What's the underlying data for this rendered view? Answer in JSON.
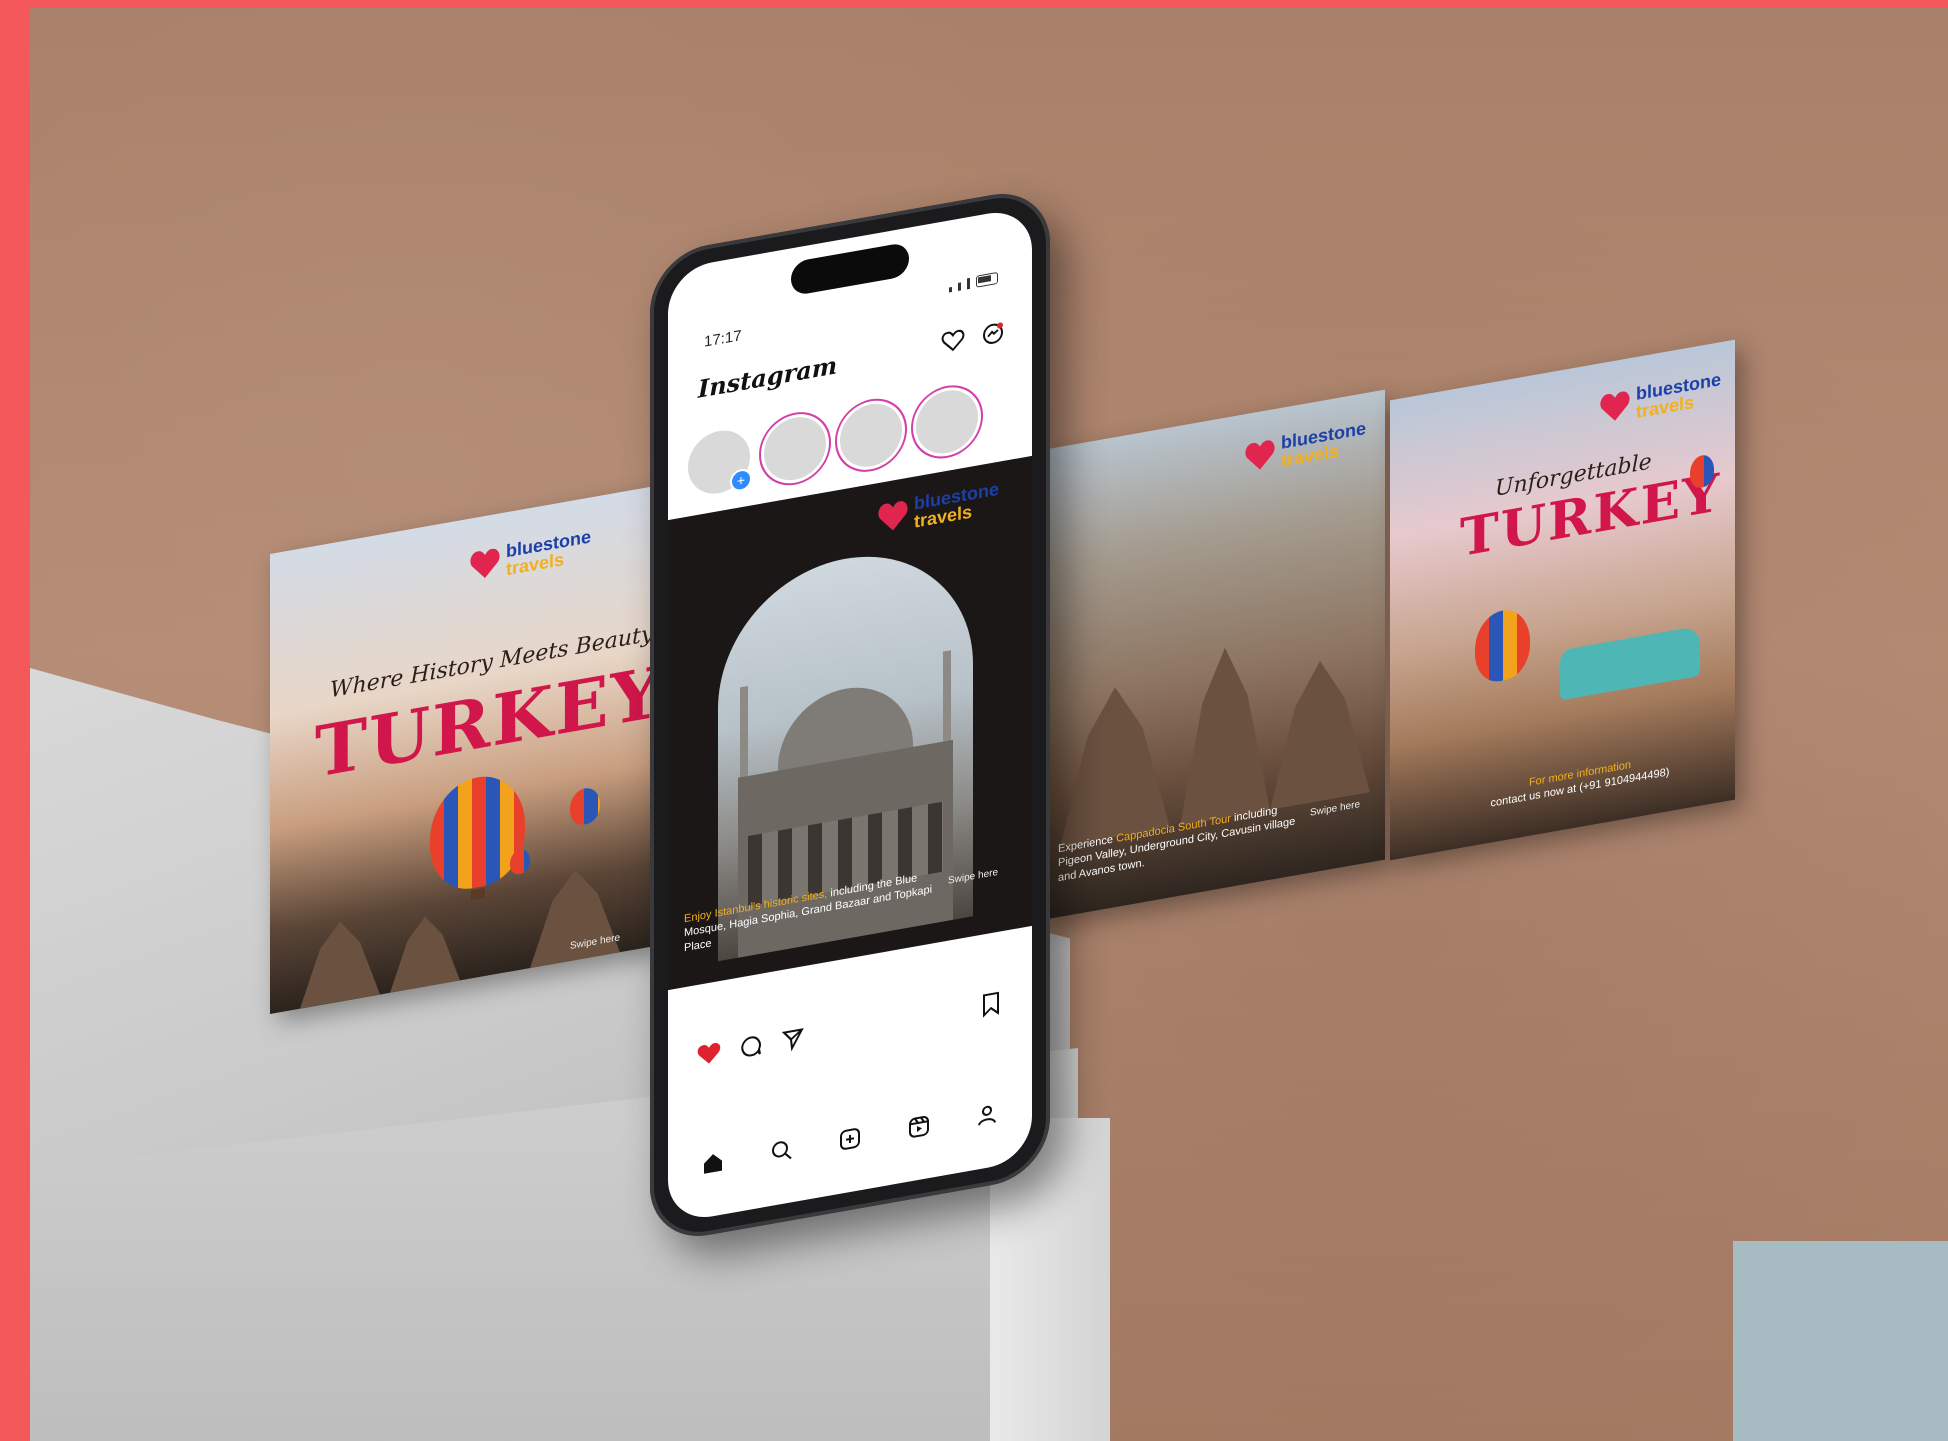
{
  "brand": {
    "name_line1": "bluestone",
    "name_line2": "travels"
  },
  "post1": {
    "script_title": "Where History Meets Beauty",
    "big_title": "TURKEY",
    "swipe": "Swipe here"
  },
  "post2": {
    "caption_highlight": "Enjoy Istanbul's historic sites,",
    "caption_rest": "including the Blue Mosque, Hagia Sophia, Grand Bazaar and Topkapi Place",
    "swipe": "Swipe here"
  },
  "post3": {
    "caption_prefix": "Experience ",
    "caption_highlight": "Cappadocia South Tour",
    "caption_rest": "including Pigeon Valley, Underground City, Cavusin village and Avanos town.",
    "swipe": "Swipe here"
  },
  "post4": {
    "script_title": "Unforgettable",
    "big_title": "TURKEY",
    "info_highlight": "For more information",
    "info_rest": "contact us now at (+91 9104944498)"
  },
  "phone": {
    "time": "17:17",
    "app_title": "Instagram"
  },
  "icons": {
    "heart": "heart-icon",
    "messenger": "messenger-icon",
    "comment": "comment-icon",
    "share": "share-icon",
    "bookmark": "bookmark-icon",
    "home": "home-icon",
    "search": "search-icon",
    "add": "add-post-icon",
    "reels": "reels-icon",
    "profile": "profile-icon"
  },
  "colors": {
    "background_frame": "#f4585a",
    "brand_pink": "#d0164a",
    "brand_blue": "#1d3fa8",
    "brand_yellow": "#f2b01e",
    "like_red": "#e0222e"
  }
}
